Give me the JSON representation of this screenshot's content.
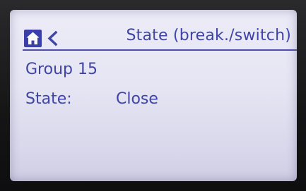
{
  "header": {
    "title": "State (break./switch)",
    "home_icon": "home-icon",
    "back_icon": "chevron-left-icon"
  },
  "content": {
    "group_label": "Group 15",
    "state_label": "State:",
    "state_value": "Close"
  },
  "colors": {
    "text": "#3f44a6",
    "accent": "#3b3fa8",
    "screen_background": "#e8e7f5"
  }
}
